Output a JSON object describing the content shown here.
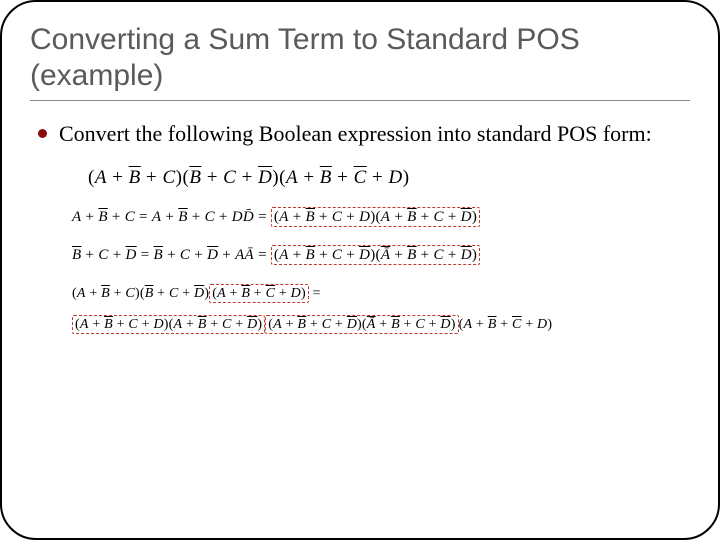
{
  "title": "Converting a Sum Term to Standard POS (example)",
  "bullet": "Convert the following Boolean expression into standard POS form:",
  "expr": {
    "t1": {
      "a": "A",
      "b": "B̄",
      "c": "C"
    },
    "t2": {
      "b": "B̄",
      "c": "C",
      "d": "D̄"
    },
    "t3": {
      "a": "A",
      "b": "B̄",
      "c": "C̄",
      "d": "D"
    }
  },
  "step1": {
    "lhs": {
      "a": "A",
      "b": "B̄",
      "c": "C"
    },
    "mid": {
      "a": "A",
      "b": "B̄",
      "c": "C",
      "dd": "DD̄"
    },
    "r1": {
      "a": "A",
      "b": "B̄",
      "c": "C",
      "d": "D"
    },
    "r2": {
      "a": "A",
      "b": "B̄",
      "c": "C",
      "d": "D̄"
    }
  },
  "step2": {
    "lhs": {
      "b": "B̄",
      "c": "C",
      "d": "D̄"
    },
    "mid": {
      "b": "B̄",
      "c": "C",
      "d": "D̄",
      "aa": "AĀ"
    },
    "r1": {
      "a": "A",
      "b": "B̄",
      "c": "C",
      "d": "D̄"
    },
    "r2": {
      "a": "Ā",
      "b": "B̄",
      "c": "C",
      "d": "D̄"
    }
  },
  "final": {
    "p1": {
      "a": "A",
      "b": "B̄",
      "c": "C"
    },
    "p2": {
      "b": "B̄",
      "c": "C",
      "d": "D̄"
    },
    "p3": {
      "a": "A",
      "b": "B̄",
      "c": "C̄",
      "d": "D"
    },
    "q1": {
      "a": "A",
      "b": "B̄",
      "c": "C",
      "d": "D"
    },
    "q2": {
      "a": "A",
      "b": "B̄",
      "c": "C",
      "d": "D̄"
    },
    "q3": {
      "a": "A",
      "b": "B̄",
      "c": "C",
      "d": "D̄"
    },
    "q4": {
      "a": "Ā",
      "b": "B̄",
      "c": "C",
      "d": "D̄"
    },
    "q5": {
      "a": "A",
      "b": "B̄",
      "c": "C̄",
      "d": "D"
    }
  },
  "sym": {
    "plus": " + ",
    "eq": " = ",
    "lp": "(",
    "rp": ")"
  }
}
